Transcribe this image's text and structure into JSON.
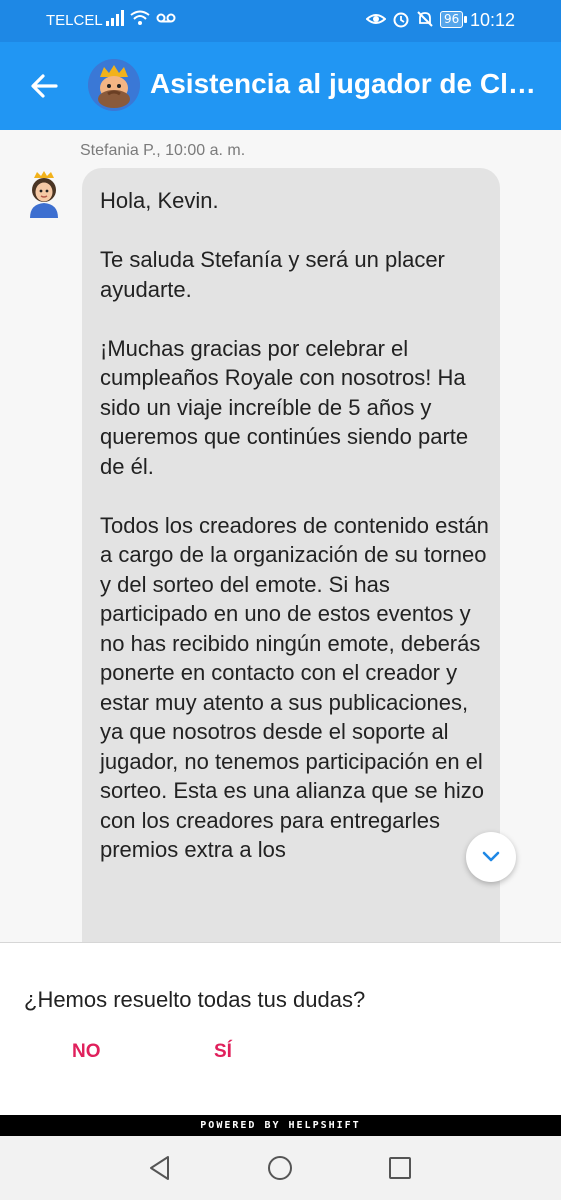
{
  "status_bar": {
    "carrier": "TELCEL",
    "battery": "96",
    "time": "10:12"
  },
  "app_bar": {
    "title": "Asistencia al jugador de Clash Royale"
  },
  "message": {
    "sender_meta": "Stefania P., 10:00 a. m.",
    "paragraphs": [
      "Hola, Kevin.",
      "Te saluda Stefanía y será un placer ayudarte.",
      "¡Muchas gracias por celebrar el cumpleaños Royale con nosotros! Ha sido un viaje increíble de 5 años y queremos que continúes siendo parte de él.",
      "Todos los creadores de contenido están a cargo de la organización de su torneo y del sorteo del emote. Si has participado en uno de estos eventos y no has recibido ningún emote, deberás ponerte en contacto con el creador y estar muy atento a sus publicaciones, ya que nosotros desde el soporte al jugador, no tenemos participación en el sorteo. Esta es una alianza que se hizo con los creadores para entregarles premios extra a los"
    ]
  },
  "feedback": {
    "question": "¿Hemos resuelto todas tus dudas?",
    "no_label": "NO",
    "yes_label": "SÍ"
  },
  "footer": {
    "powered_by": "POWERED BY HELPSHIFT"
  },
  "colors": {
    "status_bar": "#1e88e5",
    "app_bar": "#2196f3",
    "bubble": "#e3e3e3",
    "accent": "#e0205c"
  }
}
